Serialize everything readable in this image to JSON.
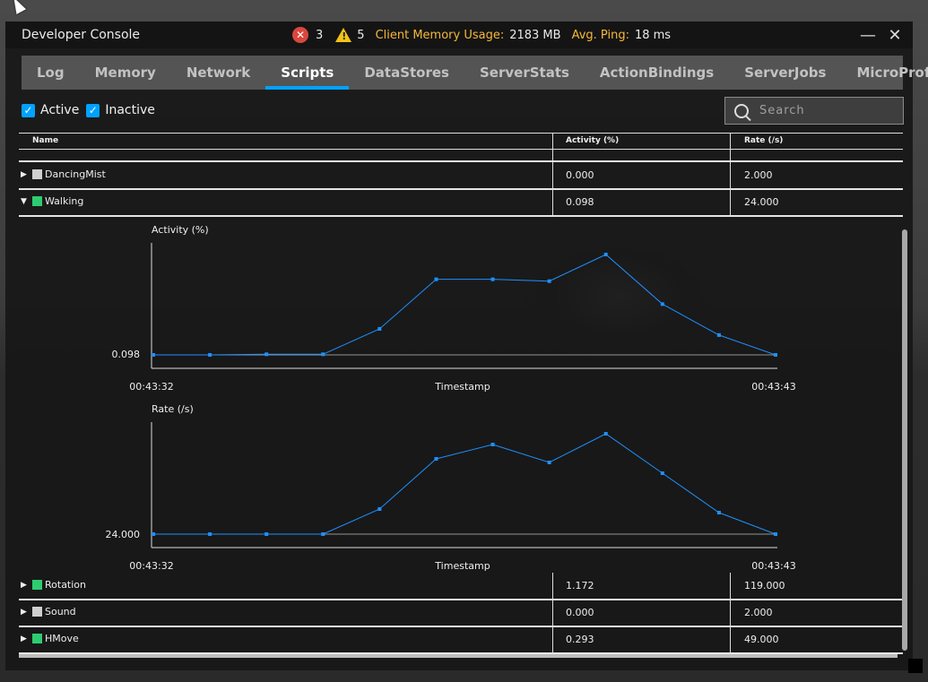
{
  "window": {
    "title": "Developer Console"
  },
  "stats": {
    "errors": "3",
    "warnings": "5",
    "memory_label": "Client Memory Usage:",
    "memory_value": "2183 MB",
    "ping_label": "Avg. Ping:",
    "ping_value": "18 ms"
  },
  "tabs": [
    "Log",
    "Memory",
    "Network",
    "Scripts",
    "DataStores",
    "ServerStats",
    "ActionBindings",
    "ServerJobs",
    "MicroProfiler"
  ],
  "active_tab": "Scripts",
  "filters": {
    "active_label": "Active",
    "inactive_label": "Inactive",
    "active_checked": true,
    "inactive_checked": true
  },
  "search": {
    "placeholder": "Search",
    "value": ""
  },
  "table": {
    "columns": {
      "name": "Name",
      "activity": "Activity (%)",
      "rate": "Rate (/s)"
    },
    "rows_top": [
      {
        "name": "DancingMist",
        "activity": "0.000",
        "rate": "2.000",
        "color": "#cfcfcf"
      },
      {
        "name": "Walking",
        "activity": "0.098",
        "rate": "24.000",
        "color": "#2ecc71",
        "expanded": true
      }
    ],
    "rows_bottom": [
      {
        "name": "Rotation",
        "activity": "1.172",
        "rate": "119.000",
        "color": "#2ecc71"
      },
      {
        "name": "Sound",
        "activity": "0.000",
        "rate": "2.000",
        "color": "#cfcfcf"
      },
      {
        "name": "HMove",
        "activity": "0.293",
        "rate": "49.000",
        "color": "#2ecc71"
      }
    ]
  },
  "chart_data": [
    {
      "type": "line",
      "title": "Activity (%)",
      "xlabel": "Timestamp",
      "x_start_label": "00:43:32",
      "x_end_label": "00:43:43",
      "y_tick_label": "0.098",
      "values": [
        0.098,
        0.098,
        0.099,
        0.099,
        0.14,
        0.22,
        0.22,
        0.217,
        0.26,
        0.18,
        0.13,
        0.098
      ],
      "color": "#1e90ff"
    },
    {
      "type": "line",
      "title": "Rate (/s)",
      "xlabel": "Timestamp",
      "x_start_label": "00:43:32",
      "x_end_label": "00:43:43",
      "y_tick_label": "24.000",
      "values": [
        24,
        24,
        24,
        24,
        31,
        45,
        49,
        44,
        52,
        41,
        30,
        24
      ],
      "color": "#1e90ff"
    }
  ]
}
